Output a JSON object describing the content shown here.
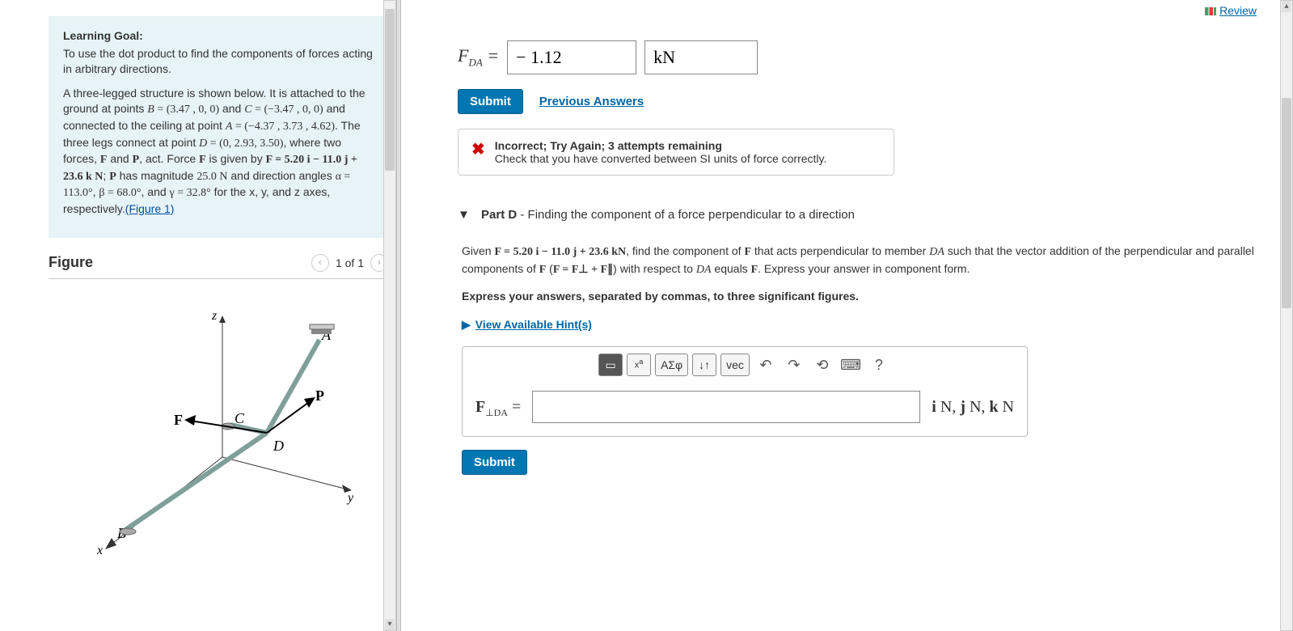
{
  "review_link": "Review",
  "left": {
    "goal_title": "Learning Goal:",
    "goal_body": "To use the dot product to find the components of forces acting in arbitrary directions.",
    "prob_l1a": "A three-legged structure is shown below. It is attached to the ground at points ",
    "B_label": "B",
    "B_eq": " = (3.47 , 0, 0)",
    "prob_l1b": " and ",
    "C_label": "C",
    "C_eq": " = (−3.47 , 0, 0)",
    "prob_l1c": " and connected to the ceiling at point ",
    "A_label": "A",
    "A_eq": " = (−4.37 , 3.73 , 4.62)",
    "prob_l1d": ". The three legs connect at point ",
    "D_label": "D",
    "D_eq": " = (0, 2.93, 3.50)",
    "prob_l1e": ", where two forces, ",
    "F_bold": "F",
    "prob_l1f": " and ",
    "P_bold": "P",
    "prob_l1g": ", act. Force ",
    "prob_l1h": " is given by ",
    "F_eq": "F = 5.20 i − 11.0 j + 23.6 k N",
    "prob_l1i": "; ",
    "P_has": " has magnitude ",
    "P_mag": "25.0 N",
    "prob_l1j": " and direction angles ",
    "alpha": "α = 113.0°",
    "beta": "β = 68.0°",
    "gamma": "γ = 32.8°",
    "prob_l1k": " for the x, y, and z axes, respectively.",
    "figure_link": "(Figure 1)",
    "figure_label": "Figure",
    "pager": "1 of 1"
  },
  "right": {
    "fda_label": "F",
    "fda_sub": "DA",
    "fda_value": "− 1.12",
    "fda_unit": "kN",
    "submit": "Submit",
    "prev": "Previous Answers",
    "fb_title": "Incorrect; Try Again; 3 attempts remaining",
    "fb_body": "Check that you have converted between SI units of force correctly.",
    "partD_label": "Part D",
    "partD_title": " - Finding the component of a force perpendicular to a direction",
    "partD_given_a": "Given ",
    "partD_F": "F = 5.20 i − 11.0 j + 23.6 kN",
    "partD_given_b": ", find the component of ",
    "partD_given_c": " that acts perpendicular to member ",
    "DA_i": "DA",
    "partD_given_d": " such that the vector addition of the perpendicular and parallel components of ",
    "partD_paren_a": " (",
    "partD_paren_eq": "F = F⊥ + F∥",
    "partD_paren_b": ") with respect to ",
    "DA_plain": "DA",
    "partD_given_e": " equals ",
    "partD_given_f": ". Express your answer in component form.",
    "partD_instr": "Express your answers, separated by commas, to three significant figures.",
    "hints": "View Available Hint(s)",
    "tb_greek": "ΑΣφ",
    "tb_vec": "vec",
    "editor_label_F": "F",
    "editor_label_sub": "⊥DA",
    "editor_units": "i N, j N, k N",
    "submit2": "Submit"
  }
}
